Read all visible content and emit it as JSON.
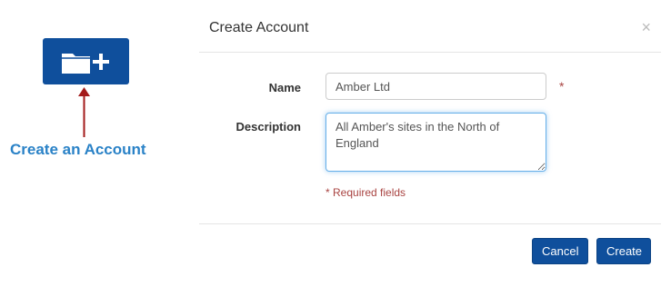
{
  "annotation": {
    "button_icon": "folder-add-icon",
    "callout_text": "Create an Account",
    "arrow_color": "#a31b1b"
  },
  "modal": {
    "title": "Create Account",
    "close_label": "×",
    "form": {
      "name_label": "Name",
      "name_value": "Amber Ltd",
      "required_marker": "*",
      "description_label": "Description",
      "description_value": "All Amber's sites in the North of England",
      "required_note": "* Required fields"
    },
    "footer": {
      "cancel_label": "Cancel",
      "create_label": "Create"
    }
  },
  "colors": {
    "primary": "#0f4f9c",
    "callout": "#2a82c7",
    "required": "#a94442"
  }
}
